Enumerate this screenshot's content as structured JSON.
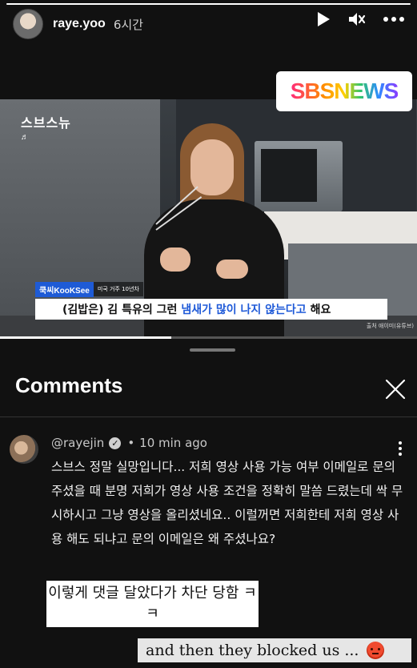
{
  "story": {
    "username": "raye.yoo",
    "time": "6시간",
    "progress": 1.0
  },
  "video": {
    "channel_logo": "스브스뉴",
    "music_note": "♬",
    "badge_text": "SBSNEWS",
    "name_tag": "쿡씨KooKSee",
    "name_tag_note": "미국 거주 10년차",
    "subtitle_prefix": "(김밥은) 김 특유의 그런",
    "subtitle_highlight": "냄새가 많이 나지 않는다고",
    "subtitle_suffix": "해요",
    "credit": "출처 애이미(유튜브)",
    "progress": 0.41
  },
  "comments": {
    "title": "Comments",
    "items": [
      {
        "handle": "@rayejin",
        "time": "10 min ago",
        "body": "스브스 정말 실망입니다... 저희 영상 사용 가능 여부 이메일로 문의 주셨을 때 분명 저희가 영상 사용 조건을 정확히 말씀 드렸는데 싹 무시하시고 그냥 영상을 올리셨네요.. 이럴꺼면 저희한테 저희 영상 사용 해도 되냐고 문의 이메일은 왜 주셨나요?"
      }
    ]
  },
  "captions": {
    "korean": "이렇게 댓글 달았다가 차단 당함 ㅋㅋ",
    "english": "and then they blocked us ..."
  },
  "icons": [
    "play-icon",
    "mute-icon",
    "more-icon",
    "close-icon",
    "verified-icon",
    "comment-more-icon",
    "angry-emoji-icon"
  ]
}
